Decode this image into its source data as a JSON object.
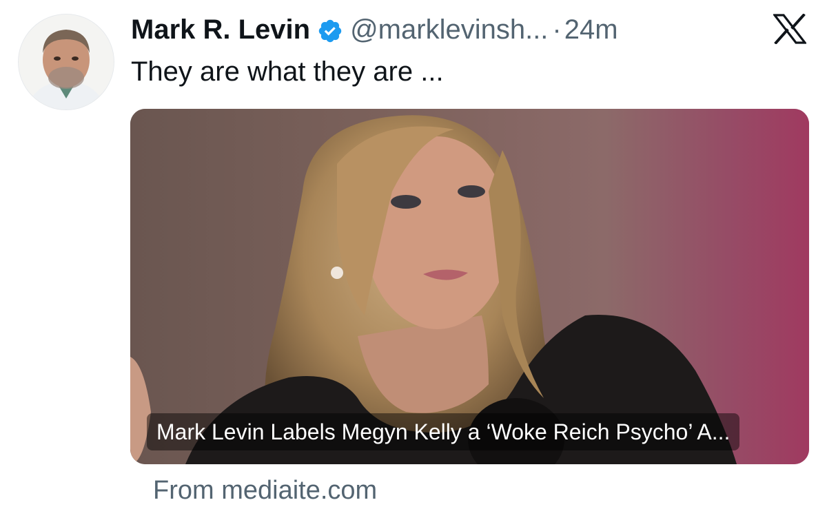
{
  "author": {
    "display_name": "Mark R. Levin",
    "handle": "@marklevinsh...",
    "separator": "·",
    "time": "24m",
    "verified": true
  },
  "tweet": {
    "text": "They are what they are ..."
  },
  "link_card": {
    "title": "Mark Levin Labels Megyn Kelly a ‘Woke Reich Psycho’ A...",
    "source": "From mediaite.com"
  },
  "icons": {
    "avatar": "avatar-photo",
    "verified": "verified-badge-icon",
    "platform": "x-logo-icon"
  },
  "colors": {
    "text_primary": "#0f1419",
    "text_secondary": "#536471",
    "verified_blue": "#1d9bf0"
  }
}
